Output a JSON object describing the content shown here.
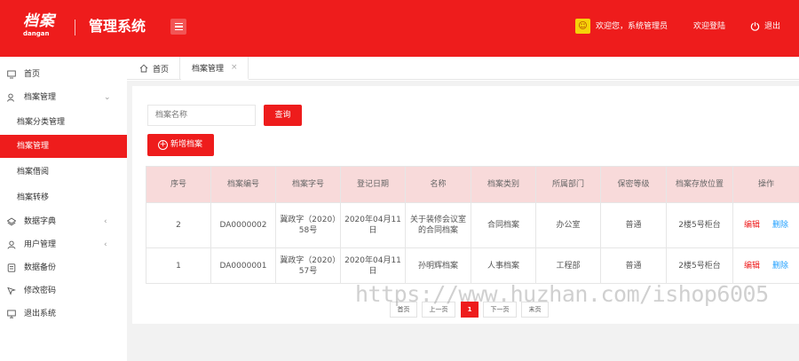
{
  "header": {
    "logo_main": "档案",
    "logo_sub": "dangan",
    "system_title": "管理系统",
    "welcome": "欢迎您，系统管理员",
    "login_link": "欢迎登陆",
    "logout": "退出",
    "accent_color": "#ee1c1c"
  },
  "sidebar": {
    "home": "首页",
    "archive_mgmt": "档案管理",
    "archive_category": "档案分类管理",
    "archive_manage": "档案管理",
    "archive_borrow": "档案借阅",
    "archive_transfer": "档案转移",
    "data_dict": "数据字典",
    "user_mgmt": "用户管理",
    "data_backup": "数据备份",
    "change_pwd": "修改密码",
    "logout_system": "退出系统"
  },
  "tabs": {
    "home": "首页",
    "active": "档案管理",
    "close_glyph": "×"
  },
  "toolbar": {
    "search_placeholder": "档案名称",
    "search_button": "查询",
    "add_button": "新增档案"
  },
  "table": {
    "headers": [
      "序号",
      "档案编号",
      "档案字号",
      "登记日期",
      "名称",
      "档案类别",
      "所属部门",
      "保密等级",
      "档案存放位置",
      "操作"
    ],
    "rows": [
      {
        "seq": "2",
        "code": "DA0000002",
        "word_no": "冀政字（2020）58号",
        "date": "2020年04月11日",
        "name": "关于装修会议室的合同档案",
        "category": "合同档案",
        "dept": "办公室",
        "level": "普通",
        "location": "2楼5号柜台",
        "edit": "编辑",
        "delete": "删除"
      },
      {
        "seq": "1",
        "code": "DA0000001",
        "word_no": "冀政字（2020）57号",
        "date": "2020年04月11日",
        "name": "孙明辉档案",
        "category": "人事档案",
        "dept": "工程部",
        "level": "普通",
        "location": "2楼5号柜台",
        "edit": "编辑",
        "delete": "删除"
      }
    ]
  },
  "pagination": {
    "first": "首页",
    "prev": "上一页",
    "current": "1",
    "next": "下一页",
    "last": "末页"
  },
  "watermark": "https://www.huzhan.com/ishop6005"
}
